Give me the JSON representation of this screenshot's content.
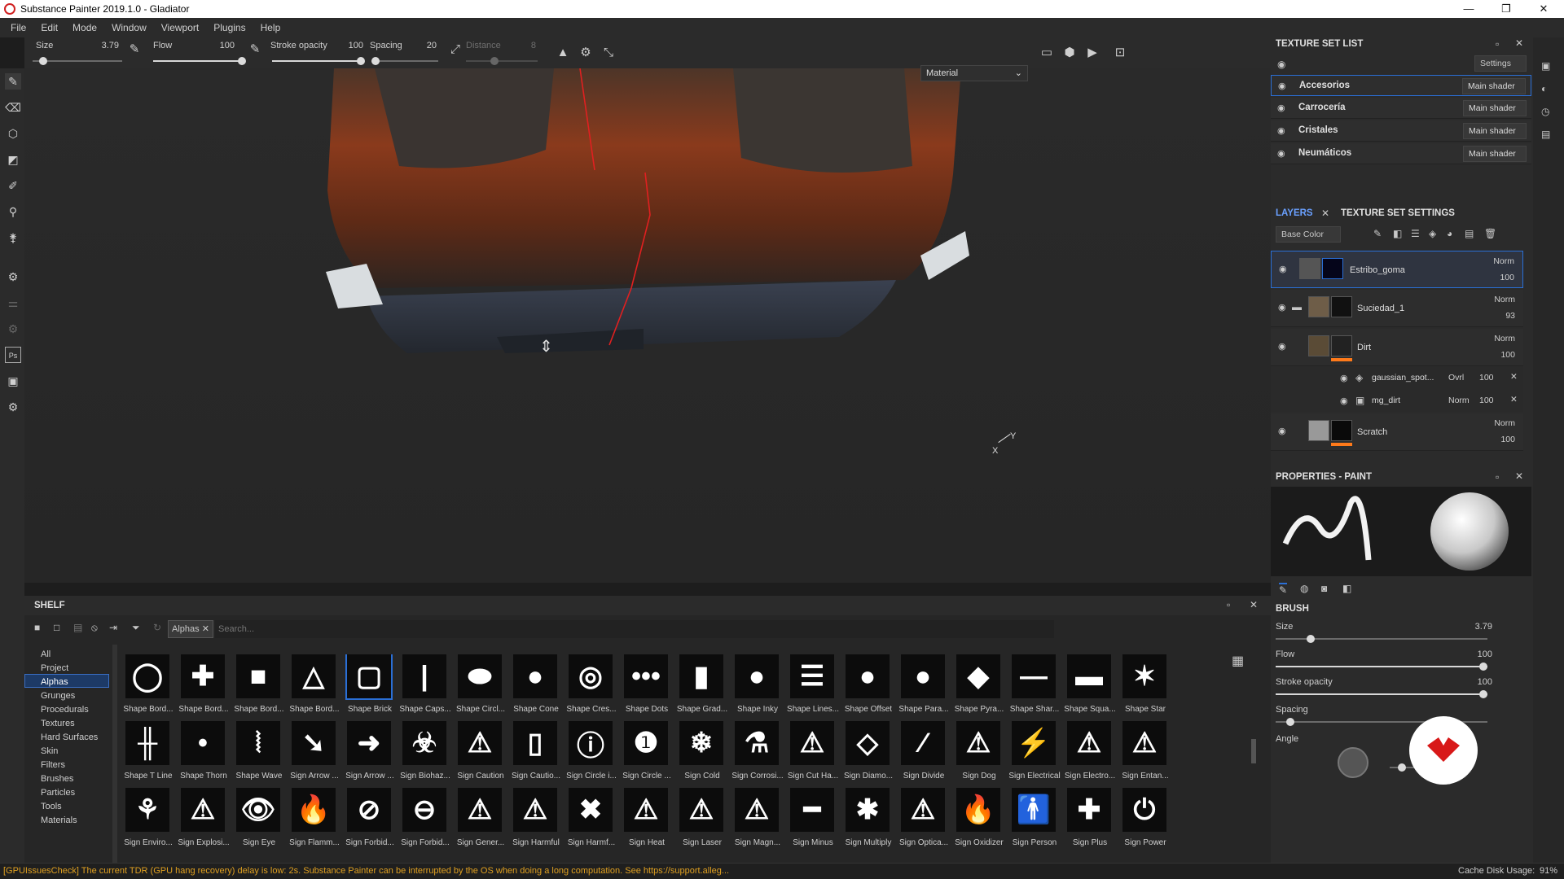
{
  "window": {
    "title": "Substance Painter 2019.1.0 - Gladiator",
    "minimize": "—",
    "maximize": "❐",
    "close": "✕"
  },
  "menu": [
    "File",
    "Edit",
    "Mode",
    "Window",
    "Viewport",
    "Plugins",
    "Help"
  ],
  "toolbar": {
    "size_label": "Size",
    "size_value": "3.79",
    "flow_label": "Flow",
    "flow_value": "100",
    "stroke_opacity_label": "Stroke opacity",
    "stroke_opacity_value": "100",
    "spacing_label": "Spacing",
    "spacing_value": "20",
    "distance_label": "Distance",
    "distance_value": "8"
  },
  "viewport": {
    "display_mode": "Material",
    "axis_x": "X",
    "axis_y": "Y"
  },
  "texture_set_list": {
    "title": "TEXTURE SET LIST",
    "settings_label": "Settings",
    "sets": [
      {
        "name": "Accesorios",
        "shader": "Main shader"
      },
      {
        "name": "Carrocería",
        "shader": "Main shader"
      },
      {
        "name": "Cristales",
        "shader": "Main shader"
      },
      {
        "name": "Neumáticos",
        "shader": "Main shader"
      }
    ]
  },
  "layers_panel": {
    "tab_layers": "LAYERS",
    "tab_texture_set_settings": "TEXTURE SET SETTINGS",
    "channel": "Base Color",
    "layers": [
      {
        "name": "Estribo_goma",
        "blend": "Norm",
        "opacity": "100"
      },
      {
        "name": "Suciedad_1",
        "blend": "Norm",
        "opacity": "93"
      },
      {
        "name": "Dirt",
        "blend": "Norm",
        "opacity": "100"
      },
      {
        "name": "Scratch",
        "blend": "Norm",
        "opacity": "100"
      }
    ],
    "sublayers": [
      {
        "name": "gaussian_spot...",
        "blend": "Ovrl",
        "opacity": "100"
      },
      {
        "name": "mg_dirt",
        "blend": "Norm",
        "opacity": "100"
      }
    ]
  },
  "properties": {
    "title": "PROPERTIES - PAINT",
    "brush_heading": "BRUSH",
    "size_label": "Size",
    "size_value": "3.79",
    "size_fraction": 0.15,
    "flow_label": "Flow",
    "flow_value": "100",
    "flow_fraction": 1.0,
    "stroke_opacity_label": "Stroke opacity",
    "stroke_opacity_value": "100",
    "stroke_opacity_fraction": 1.0,
    "spacing_label": "Spacing",
    "spacing_fraction": 0.05,
    "angle_label": "Angle"
  },
  "shelf": {
    "title": "SHELF",
    "filter_tag": "Alphas",
    "search_placeholder": "Search...",
    "categories": [
      "All",
      "Project",
      "Alphas",
      "Grunges",
      "Procedurals",
      "Textures",
      "Hard Surfaces",
      "Skin",
      "Filters",
      "Brushes",
      "Particles",
      "Tools",
      "Materials"
    ],
    "selected_category": "Alphas",
    "row1": [
      {
        "label": "Shape Bord...",
        "glyph": "◯"
      },
      {
        "label": "Shape Bord...",
        "glyph": "✚"
      },
      {
        "label": "Shape Bord...",
        "glyph": "■"
      },
      {
        "label": "Shape Bord...",
        "glyph": "△"
      },
      {
        "label": "Shape Brick",
        "glyph": "▢"
      },
      {
        "label": "Shape Caps...",
        "glyph": "|"
      },
      {
        "label": "Shape Circl...",
        "glyph": "⬬"
      },
      {
        "label": "Shape Cone",
        "glyph": "●"
      },
      {
        "label": "Shape Cres...",
        "glyph": "◎"
      },
      {
        "label": "Shape Dots",
        "glyph": "•••"
      },
      {
        "label": "Shape Grad...",
        "glyph": "▮"
      },
      {
        "label": "Shape Inky",
        "glyph": "●"
      },
      {
        "label": "Shape Lines...",
        "glyph": "☰"
      },
      {
        "label": "Shape Offset",
        "glyph": "●"
      },
      {
        "label": "Shape Para...",
        "glyph": "●"
      },
      {
        "label": "Shape Pyra...",
        "glyph": "◆"
      },
      {
        "label": "Shape Shar...",
        "glyph": "—"
      },
      {
        "label": "Shape Squa...",
        "glyph": "▬"
      },
      {
        "label": "Shape Star",
        "glyph": "✶"
      }
    ],
    "row2": [
      {
        "label": "Shape T Line",
        "glyph": "╫"
      },
      {
        "label": "Shape Thorn",
        "glyph": "•"
      },
      {
        "label": "Shape Wave",
        "glyph": "⦚"
      },
      {
        "label": "Sign Arrow ...",
        "glyph": "➘"
      },
      {
        "label": "Sign Arrow ...",
        "glyph": "➜"
      },
      {
        "label": "Sign Biohaz...",
        "glyph": "☣"
      },
      {
        "label": "Sign Caution",
        "glyph": "⚠"
      },
      {
        "label": "Sign Cautio...",
        "glyph": "▯"
      },
      {
        "label": "Sign Circle i...",
        "glyph": "ⓘ"
      },
      {
        "label": "Sign Circle ...",
        "glyph": "❶"
      },
      {
        "label": "Sign Cold",
        "glyph": "❄"
      },
      {
        "label": "Sign Corrosi...",
        "glyph": "⚗"
      },
      {
        "label": "Sign Cut Ha...",
        "glyph": "⚠"
      },
      {
        "label": "Sign Diamo...",
        "glyph": "◇"
      },
      {
        "label": "Sign Divide",
        "glyph": "∕"
      },
      {
        "label": "Sign Dog",
        "glyph": "⚠"
      },
      {
        "label": "Sign Electrical",
        "glyph": "⚡"
      },
      {
        "label": "Sign Electro...",
        "glyph": "⚠"
      },
      {
        "label": "Sign Entan...",
        "glyph": "⚠"
      }
    ],
    "row3": [
      {
        "label": "Sign Enviro...",
        "glyph": "⚘"
      },
      {
        "label": "Sign Explosi...",
        "glyph": "⚠"
      },
      {
        "label": "Sign Eye",
        "glyph": "👁"
      },
      {
        "label": "Sign Flamm...",
        "glyph": "🔥"
      },
      {
        "label": "Sign Forbid...",
        "glyph": "⊘"
      },
      {
        "label": "Sign Forbid...",
        "glyph": "⊖"
      },
      {
        "label": "Sign Gener...",
        "glyph": "⚠"
      },
      {
        "label": "Sign Harmful",
        "glyph": "⚠"
      },
      {
        "label": "Sign Harmf...",
        "glyph": "✖"
      },
      {
        "label": "Sign Heat",
        "glyph": "⚠"
      },
      {
        "label": "Sign Laser",
        "glyph": "⚠"
      },
      {
        "label": "Sign Magn...",
        "glyph": "⚠"
      },
      {
        "label": "Sign Minus",
        "glyph": "━"
      },
      {
        "label": "Sign Multiply",
        "glyph": "✱"
      },
      {
        "label": "Sign Optica...",
        "glyph": "⚠"
      },
      {
        "label": "Sign Oxidizer",
        "glyph": "🔥"
      },
      {
        "label": "Sign Person",
        "glyph": "🚹"
      },
      {
        "label": "Sign Plus",
        "glyph": "✚"
      },
      {
        "label": "Sign Power",
        "glyph": "⏻"
      }
    ]
  },
  "status": {
    "message": "[GPUIssuesCheck] The current TDR (GPU hang recovery) delay is low: 2s. Substance Painter can be interrupted by the OS when doing a long computation. See https://support.alleg...",
    "cache_label": "Cache Disk Usage:",
    "cache_value": "91%"
  },
  "colors": {
    "accent": "#2a6fd6",
    "status_warning": "#e0a020",
    "orange": "#ff7a1a"
  }
}
